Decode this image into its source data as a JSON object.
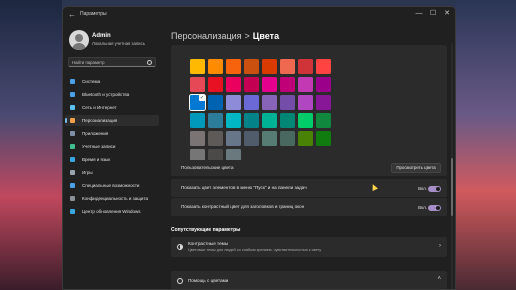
{
  "window": {
    "app_title": "Параметры",
    "back_icon": "back-arrow-icon",
    "controls": {
      "minimize": "—",
      "maximize": "☐",
      "close": "✕"
    }
  },
  "user": {
    "name": "Admin",
    "account_type": "Локальная учетная запись"
  },
  "search": {
    "placeholder": "Найти параметр"
  },
  "sidebar": {
    "items": [
      {
        "label": "Система",
        "icon": "system-icon",
        "color": "#4aa0e6",
        "active": false
      },
      {
        "label": "Bluetooth и устройства",
        "icon": "bluetooth-icon",
        "color": "#4aa0e6",
        "active": false
      },
      {
        "label": "Сеть и Интернет",
        "icon": "network-icon",
        "color": "#5bc0f5",
        "active": false
      },
      {
        "label": "Персонализация",
        "icon": "pen-icon",
        "color": "#f0a04b",
        "active": true
      },
      {
        "label": "Приложения",
        "icon": "apps-icon",
        "color": "#7f8fa6",
        "active": false
      },
      {
        "label": "Учетные записи",
        "icon": "accounts-icon",
        "color": "#3fbf8f",
        "active": false
      },
      {
        "label": "Время и язык",
        "icon": "time-icon",
        "color": "#3aa6e0",
        "active": false
      },
      {
        "label": "Игры",
        "icon": "games-icon",
        "color": "#9aa3ad",
        "active": false
      },
      {
        "label": "Специальные возможности",
        "icon": "accessibility-icon",
        "color": "#4aa0e6",
        "active": false
      },
      {
        "label": "Конфиденциальность и защита",
        "icon": "shield-icon",
        "color": "#8a8f98",
        "active": false
      },
      {
        "label": "Центр обновления Windows",
        "icon": "update-icon",
        "color": "#3aa6e0",
        "active": false
      }
    ]
  },
  "header": {
    "breadcrumb_parent": "Персонализация",
    "separator": ">",
    "breadcrumb_current": "Цвета"
  },
  "accent_colors": {
    "rows": [
      [
        "#ffb900",
        "#ff8c00",
        "#f7630c",
        "#ca5010",
        "#da3b01",
        "#ef6950",
        "#d13438",
        "#ff4343"
      ],
      [
        "#e74856",
        "#e81123",
        "#ea005e",
        "#c30052",
        "#e3008c",
        "#bf0077",
        "#c239b3",
        "#9a0089"
      ],
      [
        "#0078d4",
        "#0063b1",
        "#8e8cd8",
        "#6b69d6",
        "#8764b8",
        "#744da9",
        "#b146c2",
        "#881798"
      ],
      [
        "#0099bc",
        "#2d7d9a",
        "#00b7c3",
        "#038387",
        "#00b294",
        "#018574",
        "#00cc6a",
        "#10893e"
      ],
      [
        "#7a7574",
        "#5d5a58",
        "#68768a",
        "#515c6b",
        "#567c73",
        "#486860",
        "#498205",
        "#107c10"
      ],
      [
        "#767676",
        "#4c4a48",
        "#69797e",
        "#4a5459",
        "#647c64",
        "#525e54",
        "#847545",
        "#7e735f"
      ]
    ],
    "selected_row": 2,
    "selected_col": 0
  },
  "custom_colors": {
    "label": "Пользовательские цвета",
    "button_label": "Просмотреть цвета"
  },
  "toggles": [
    {
      "label": "Показать цвет элементов в меню \"Пуск\" и на панели задач",
      "state_text": "Вкл."
    },
    {
      "label": "Показать контрастный цвет для заголовков и границ окон",
      "state_text": "Вкл."
    }
  ],
  "related": {
    "title": "Сопутствующие параметры",
    "contrast": {
      "title": "Контрастные темы",
      "subtitle": "Цветовые темы для людей со слабым зрением, чувствительностью к свету"
    },
    "help": {
      "title": "Помощь с цветами"
    }
  }
}
